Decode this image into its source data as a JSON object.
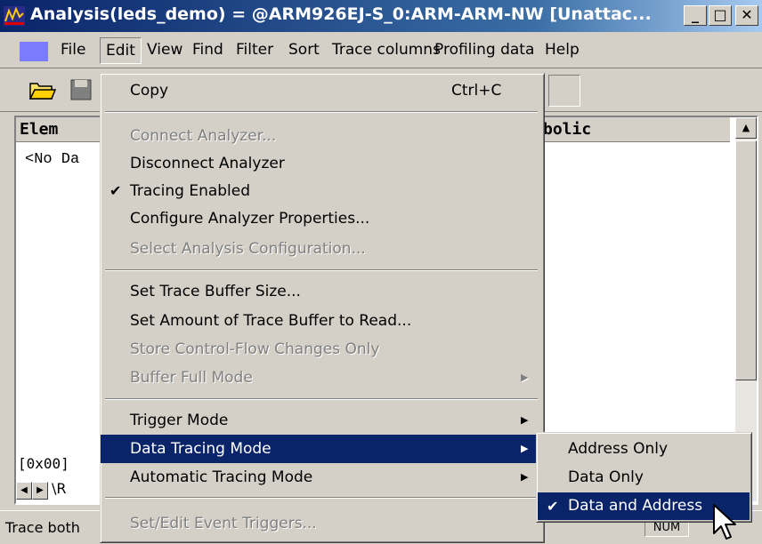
{
  "window": {
    "title": "Analysis(leds_demo) = @ARM926EJ-S_0:ARM-ARM-NW [Unattac...",
    "controls": {
      "minimize": "_",
      "maximize": "□",
      "close": "✕"
    }
  },
  "menubar": {
    "items": [
      {
        "label": "File"
      },
      {
        "label": "Edit"
      },
      {
        "label": "View"
      },
      {
        "label": "Find"
      },
      {
        "label": "Filter"
      },
      {
        "label": "Sort"
      },
      {
        "label": "Trace columns"
      },
      {
        "label": "Profiling data"
      },
      {
        "label": "Help"
      }
    ]
  },
  "list": {
    "columns": [
      "Elem",
      "bolic"
    ],
    "empty_text": "<No Da",
    "address": "[0x00]",
    "tab_label": "R"
  },
  "status": {
    "text": "Trace both",
    "indicator": "NUM"
  },
  "edit_menu": {
    "items": [
      {
        "label": "Copy",
        "shortcut": "Ctrl+C"
      },
      {
        "label": "Connect Analyzer..."
      },
      {
        "label": "Disconnect Analyzer"
      },
      {
        "label": "Tracing Enabled",
        "check": "✔"
      },
      {
        "label": "Configure Analyzer Properties..."
      },
      {
        "label": "Select Analysis Configuration..."
      },
      {
        "label": "Set Trace Buffer Size..."
      },
      {
        "label": "Set Amount of Trace Buffer to Read..."
      },
      {
        "label": "Store Control-Flow Changes Only"
      },
      {
        "label": "Buffer Full Mode",
        "arrow": "▶"
      },
      {
        "label": "Trigger Mode",
        "arrow": "▶"
      },
      {
        "label": "Data Tracing Mode",
        "arrow": "▶"
      },
      {
        "label": "Automatic Tracing Mode",
        "arrow": "▶"
      },
      {
        "label": "Set/Edit Event Triggers..."
      }
    ]
  },
  "submenu": {
    "items": [
      {
        "label": "Address Only"
      },
      {
        "label": "Data Only"
      },
      {
        "label": "Data and Address",
        "check": "✔"
      }
    ]
  },
  "colors": {
    "highlight": "#0a246a",
    "face": "#d4d0c8",
    "title_start": "#0a246a",
    "title_end": "#a6caf0"
  }
}
